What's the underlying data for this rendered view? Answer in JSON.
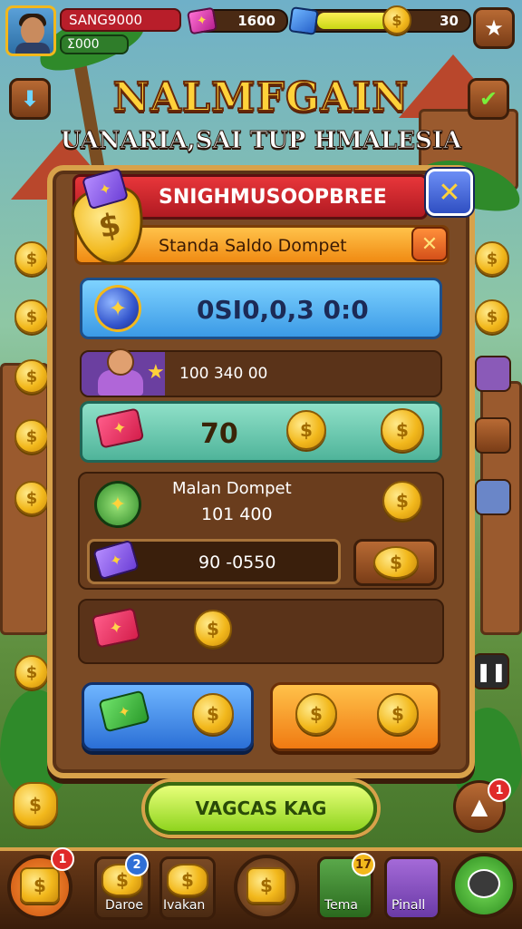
{
  "player": {
    "name_value": "SANG9000",
    "xp_value": "Σ000"
  },
  "resources": {
    "gems": "1600",
    "energy": "30"
  },
  "title": {
    "main": "NALMFGAIN",
    "sub": "UANARIA,SAI TUP HMALESIA"
  },
  "panel": {
    "header": "SNIGHMUSOOPBREE",
    "sub_header": "Standa Saldo Dompet",
    "balance": "0SI0,0,3 0:0",
    "row_amount": "100 340 00",
    "gem_amount": "70",
    "section_label": "Malan Dompet",
    "section_amount": "101 400",
    "input_amount": "90 -0550"
  },
  "cta": {
    "label": "VAGCAS KAG"
  },
  "nav": {
    "badge_first": "1",
    "badge_second": "2",
    "badge_fourth": "17",
    "badge_corner": "1",
    "label_second": "Daroe",
    "label_third": "Ivakan",
    "label_fifth": "Tema",
    "label_sixth": "Pinall"
  },
  "icons": {
    "settings": "star-icon",
    "back": "arrow-down-icon",
    "confirm": "check-icon",
    "close": "close-icon"
  },
  "colors": {
    "header_red": "#d8262e",
    "sub_header_orange": "#f5a028",
    "balance_blue": "#4fb0f0",
    "teal_row": "#6fcdb2",
    "cta_green": "#b5ec3a",
    "gold": "#f2b81c"
  }
}
